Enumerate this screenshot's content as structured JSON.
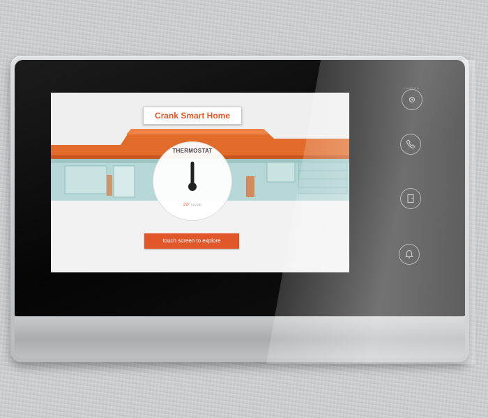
{
  "screen": {
    "title": "Crank Smart Home",
    "thermostat": {
      "label": "THERMOSTAT",
      "temperature": "23°",
      "temperature_sub": " inside"
    },
    "explore_button": "touch screen to explore"
  },
  "hardware": {
    "camera_label": "CAMERA",
    "buttons": [
      "camera-icon",
      "phone-icon",
      "door-icon",
      "bell-icon"
    ]
  },
  "colors": {
    "accent": "#e1572a",
    "roof": "#e06b2a",
    "house": "#b5d7d6",
    "bezel": "#0a0a0a"
  }
}
